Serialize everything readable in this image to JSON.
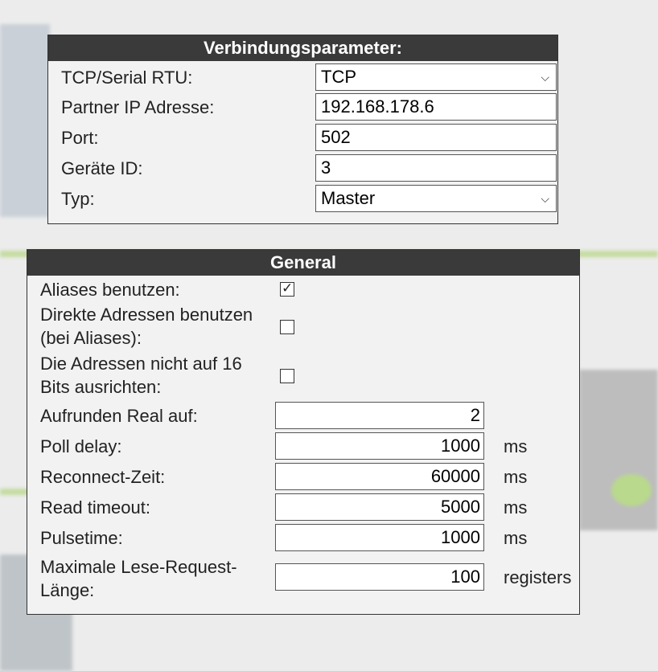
{
  "connection": {
    "title": "Verbindungsparameter:",
    "rows": [
      {
        "label": "TCP/Serial RTU:",
        "value": "TCP"
      },
      {
        "label": "Partner IP Adresse:",
        "value": "192.168.178.6"
      },
      {
        "label": "Port:",
        "value": "502"
      },
      {
        "label": "Geräte ID:",
        "value": "3"
      },
      {
        "label": "Typ:",
        "value": "Master"
      }
    ]
  },
  "general": {
    "title": "General",
    "checkboxes": [
      {
        "label": "Aliases benutzen:",
        "checked": true
      },
      {
        "label": "Direkte Adressen benutzen (bei Aliases):",
        "checked": false
      },
      {
        "label": "Die Adressen nicht auf 16 Bits ausrichten:",
        "checked": false
      }
    ],
    "fields": [
      {
        "label": "Aufrunden Real auf:",
        "value": "2",
        "unit": ""
      },
      {
        "label": "Poll delay:",
        "value": "1000",
        "unit": "ms"
      },
      {
        "label": "Reconnect-Zeit:",
        "value": "60000",
        "unit": "ms"
      },
      {
        "label": "Read timeout:",
        "value": "5000",
        "unit": "ms"
      },
      {
        "label": "Pulsetime:",
        "value": "1000",
        "unit": "ms"
      },
      {
        "label": "Maximale Lese-Request-Länge:",
        "value": "100",
        "unit": "registers"
      }
    ]
  }
}
